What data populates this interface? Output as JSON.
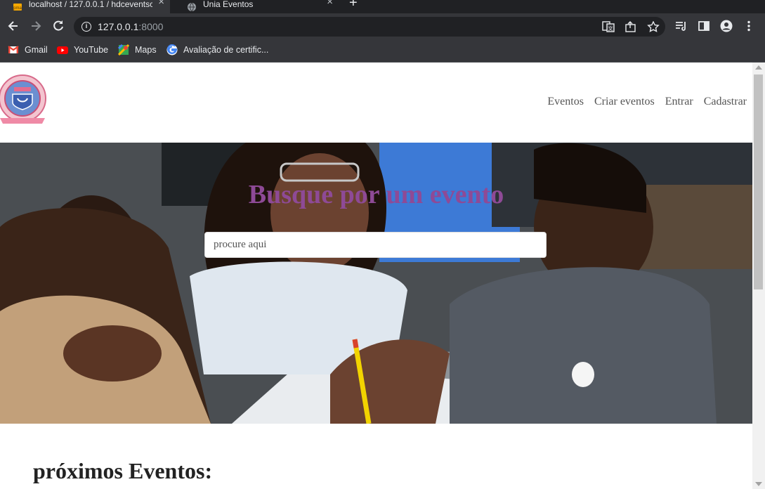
{
  "browser": {
    "tabs": [
      {
        "title": "localhost / 127.0.0.1 / hdceventsc",
        "active": true,
        "icon": "phpmyadmin-icon"
      },
      {
        "title": "Unia Eventos",
        "active": false,
        "icon": "globe-icon"
      }
    ],
    "new_tab": "+",
    "url_host": "127.0.0.1",
    "url_port": ":8000",
    "bookmarks": [
      {
        "label": "Gmail",
        "icon": "gmail-icon"
      },
      {
        "label": "YouTube",
        "icon": "youtube-icon"
      },
      {
        "label": "Maps",
        "icon": "maps-icon"
      },
      {
        "label": "Avaliação de certific...",
        "icon": "google-icon"
      }
    ]
  },
  "site": {
    "logo_icon": "university-seal-icon",
    "nav": [
      "Eventos",
      "Criar eventos",
      "Entrar",
      "Cadastrar"
    ],
    "hero": {
      "title": "Busque por um evento",
      "search_placeholder": "procure aqui"
    },
    "upcoming_title": "próximos Eventos:"
  },
  "colors": {
    "accent": "#8e4a96",
    "chrome_dark": "#202124",
    "chrome_toolbar": "#35363a"
  }
}
